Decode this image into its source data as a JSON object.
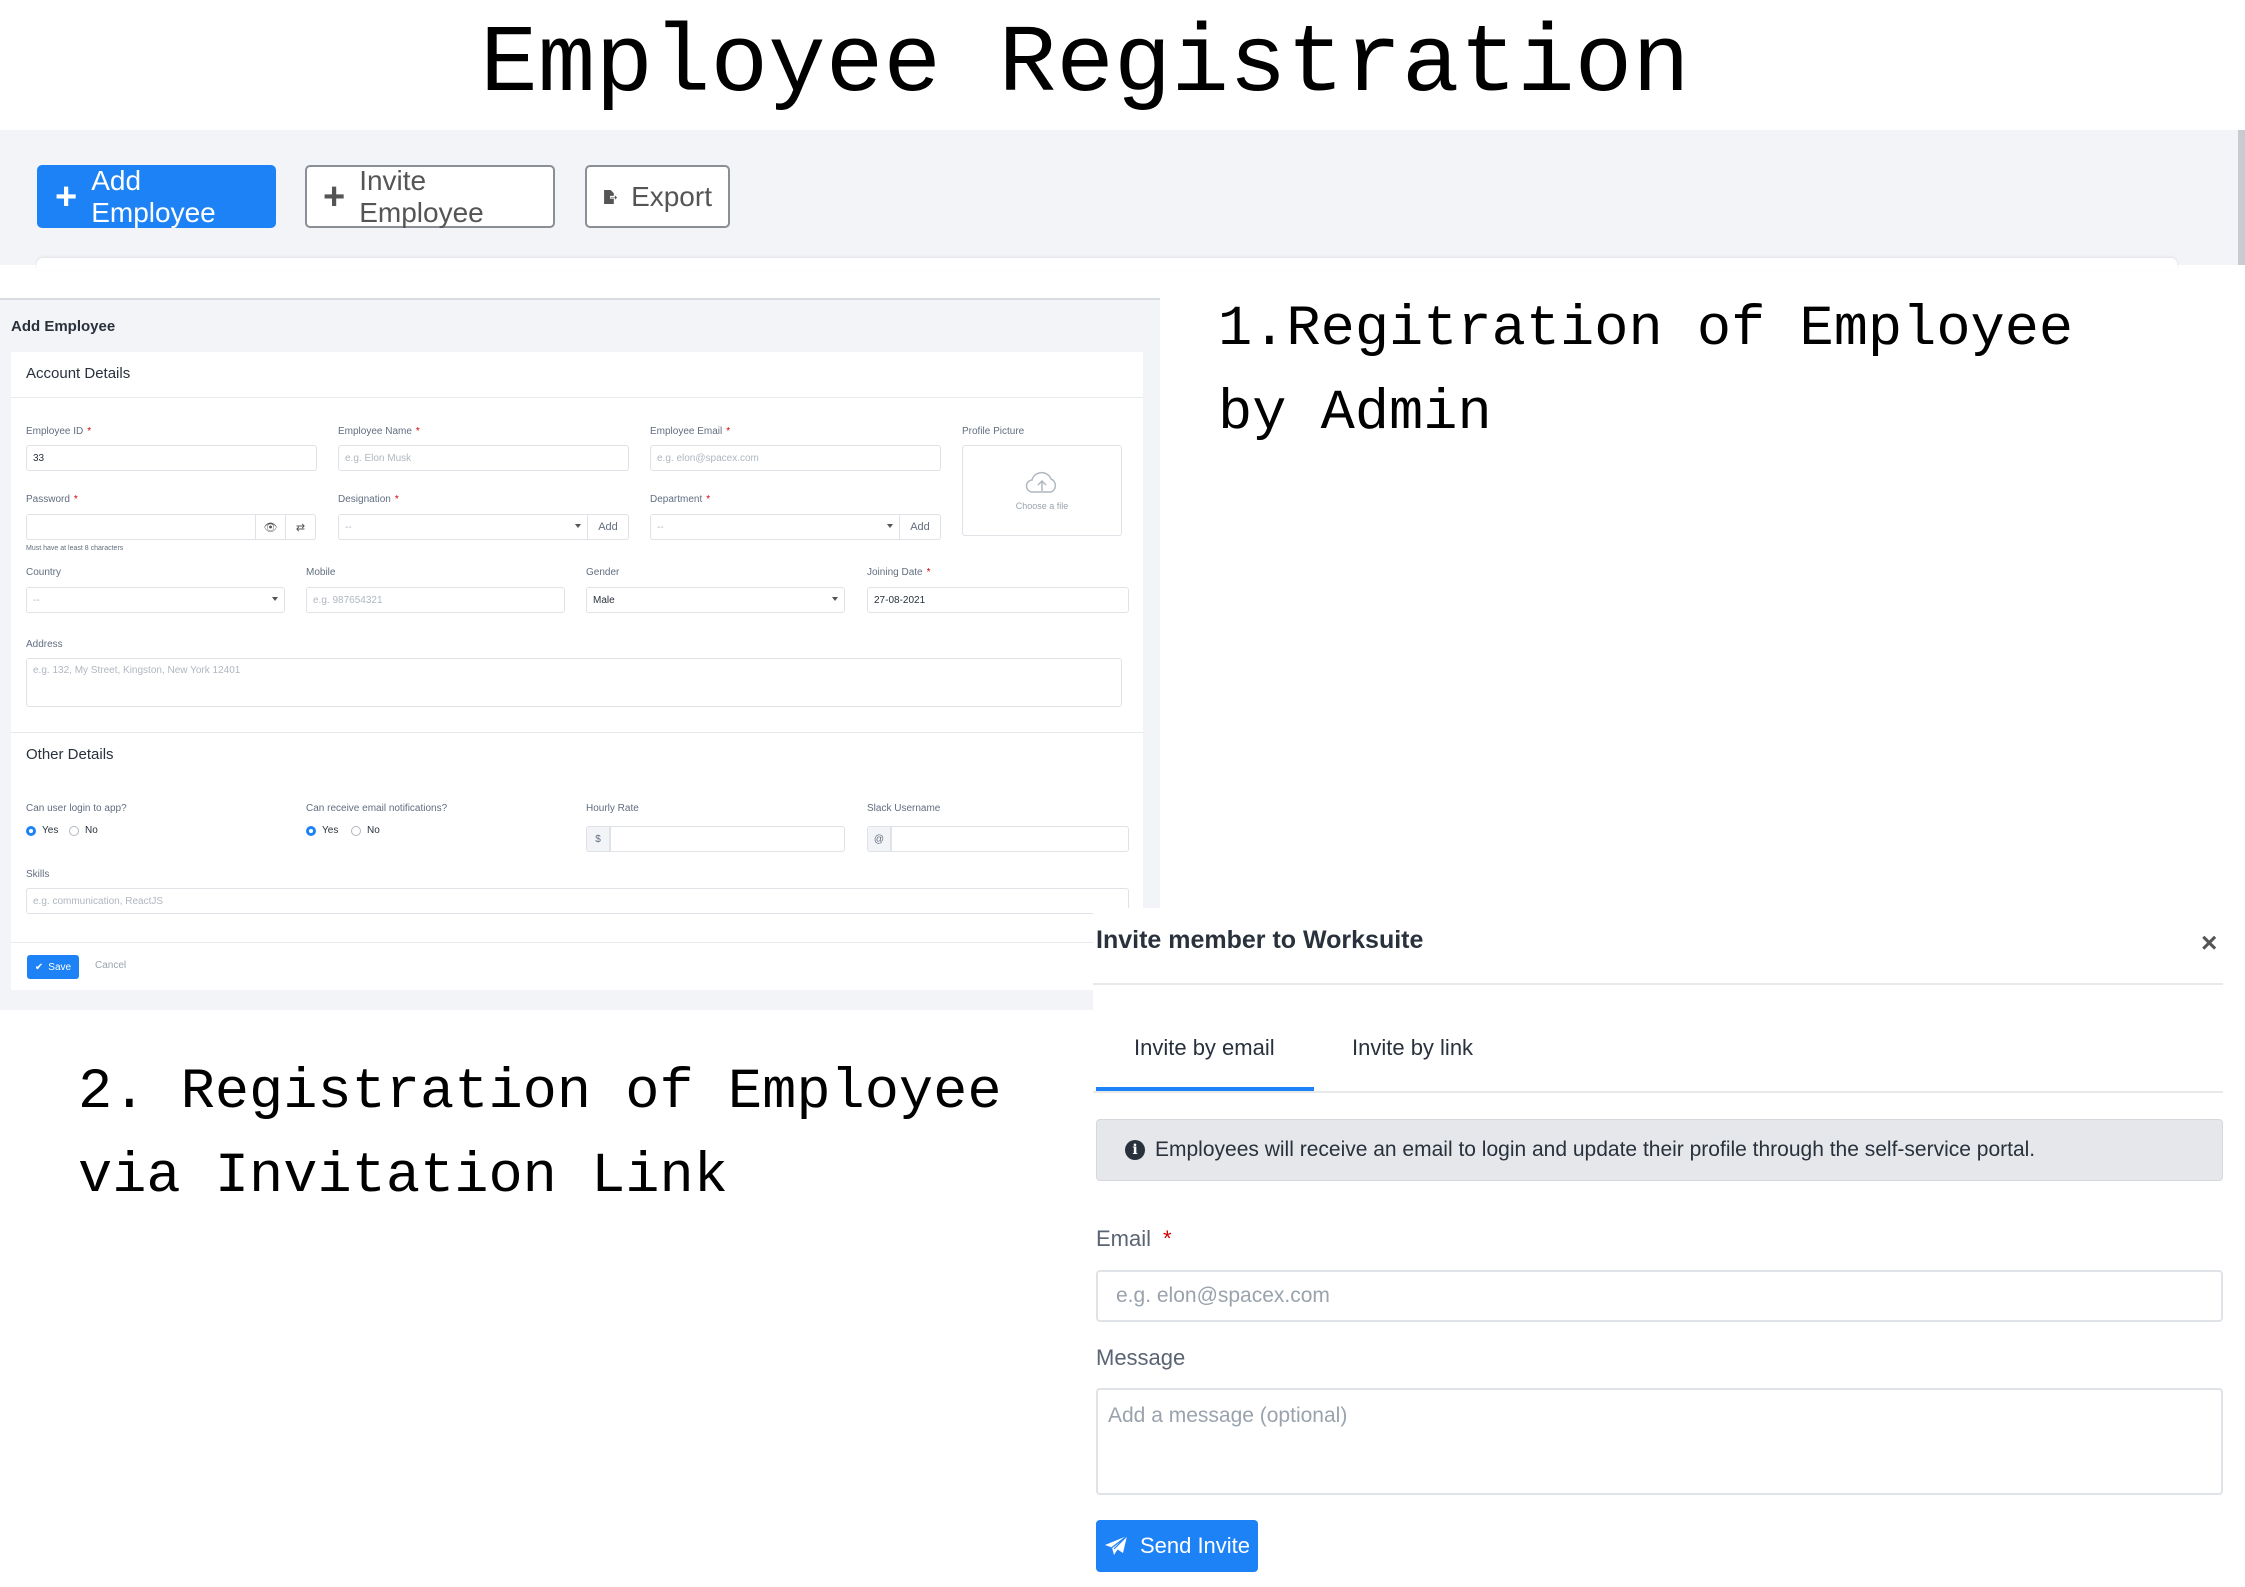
{
  "page": {
    "title": "Employee Registration",
    "annotation_1": "1.Regitration of Employee by Admin",
    "annotation_2": "2. Registration of Employee via Invitation Link"
  },
  "toolbar": {
    "add_employee": "Add Employee",
    "invite_employee": "Invite Employee",
    "export": "Export"
  },
  "add_employee_form": {
    "title": "Add Employee",
    "account_details": "Account Details",
    "employee_id": {
      "label": "Employee ID",
      "value": "33"
    },
    "employee_name": {
      "label": "Employee Name",
      "placeholder": "e.g. Elon Musk"
    },
    "employee_email": {
      "label": "Employee Email",
      "placeholder": "e.g. elon@spacex.com"
    },
    "profile_picture": {
      "label": "Profile Picture",
      "choose": "Choose a file"
    },
    "password": {
      "label": "Password",
      "hint": "Must have at least 8 characters"
    },
    "designation": {
      "label": "Designation",
      "value": "--",
      "add": "Add"
    },
    "department": {
      "label": "Department",
      "value": "--",
      "add": "Add"
    },
    "country": {
      "label": "Country",
      "value": "--"
    },
    "mobile": {
      "label": "Mobile",
      "placeholder": "e.g. 987654321"
    },
    "gender": {
      "label": "Gender",
      "value": "Male"
    },
    "joining_date": {
      "label": "Joining Date",
      "value": "27-08-2021"
    },
    "address": {
      "label": "Address",
      "placeholder": "e.g. 132, My Street, Kingston, New York 12401"
    },
    "other_details": "Other Details",
    "login_app": {
      "label": "Can user login to app?",
      "yes": "Yes",
      "no": "No"
    },
    "email_notifications": {
      "label": "Can receive email notifications?",
      "yes": "Yes",
      "no": "No"
    },
    "hourly_rate": {
      "label": "Hourly Rate",
      "prefix": "$"
    },
    "slack_username": {
      "label": "Slack Username",
      "prefix": "@"
    },
    "skills": {
      "label": "Skills",
      "placeholder": "e.g. communication, ReactJS"
    },
    "save": "Save",
    "cancel": "Cancel"
  },
  "invite_modal": {
    "title": "Invite member to Worksuite",
    "close": "×",
    "tabs": [
      "Invite by email",
      "Invite by link"
    ],
    "active_tab": "Invite by email",
    "alert": "Employees will receive an email to login and update their profile through the self-service portal.",
    "email_label": "Email",
    "email_placeholder": "e.g. elon@spacex.com",
    "message_label": "Message",
    "message_placeholder": "Add a message (optional)",
    "send": "Send Invite"
  },
  "colors": {
    "primary": "#1d82f5",
    "required": "#d30000",
    "panel_bg": "#f2f4f7"
  }
}
